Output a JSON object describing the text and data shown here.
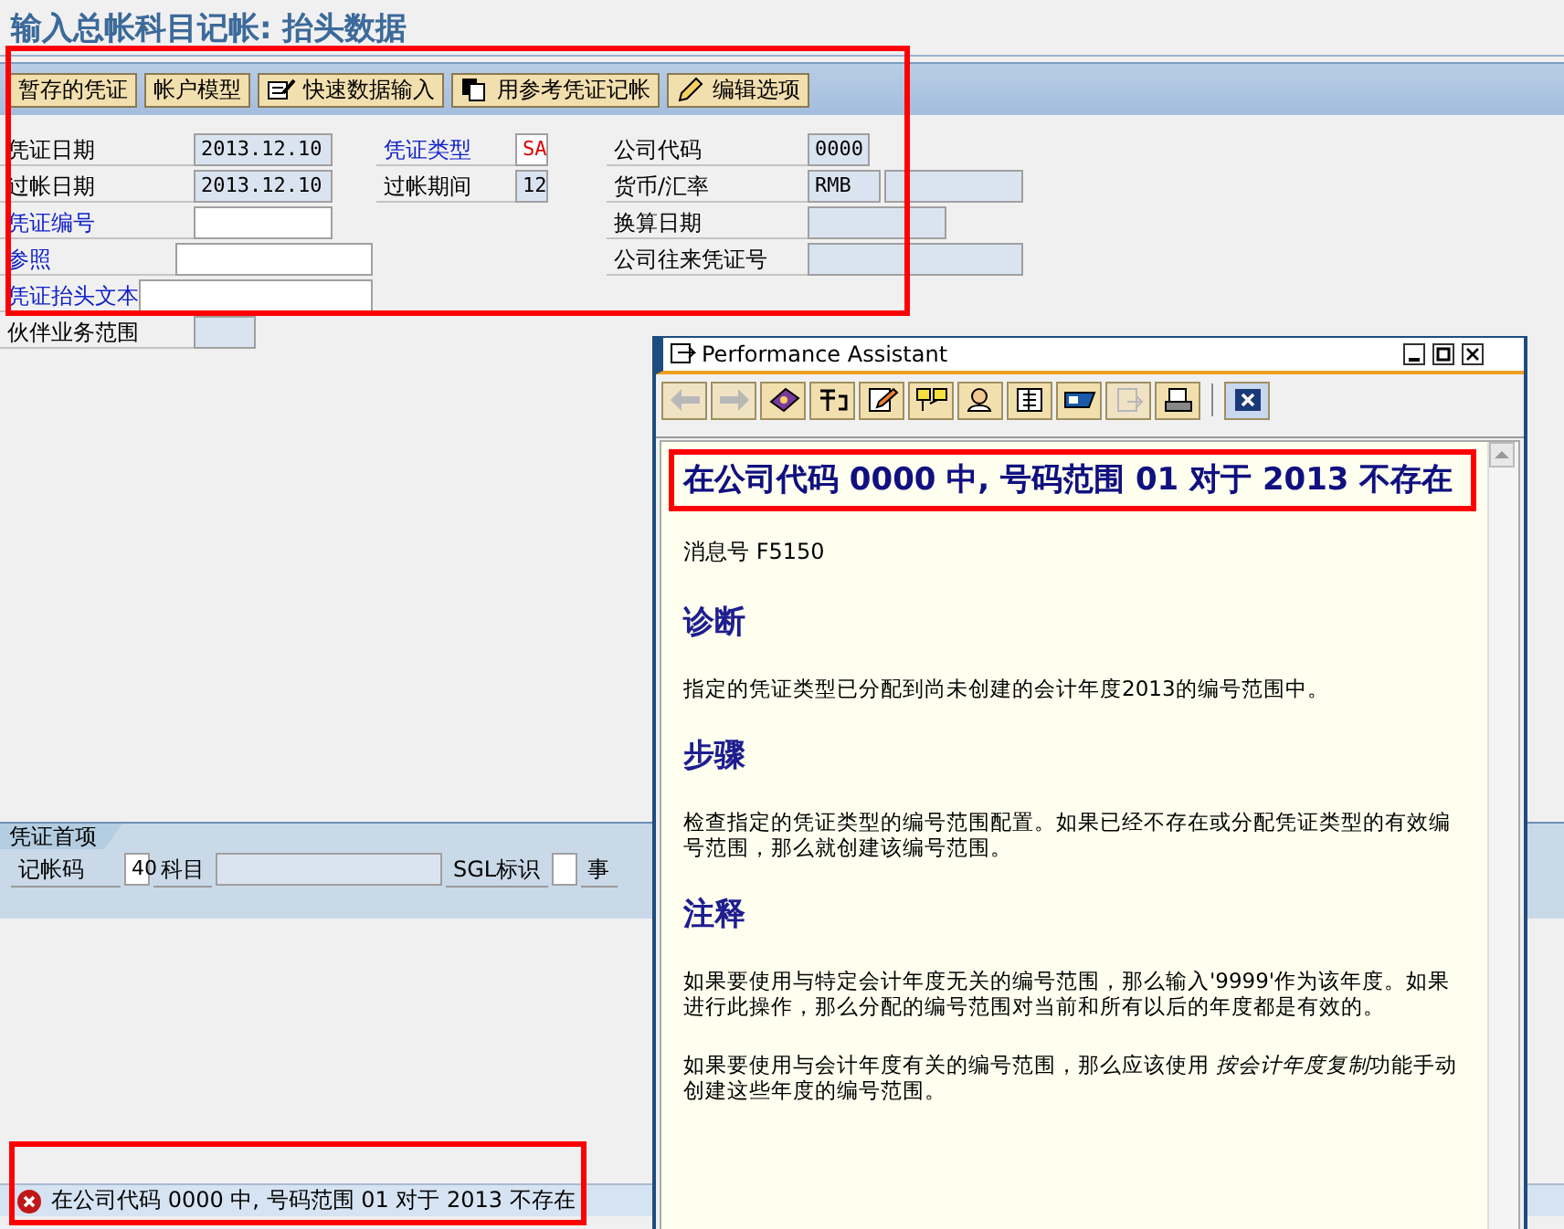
{
  "title": "输入总帐科目记帐: 抬头数据",
  "toolbar": [
    {
      "label": "暂存的凭证",
      "kind": "plain"
    },
    {
      "label": "帐户模型",
      "kind": "plain"
    },
    {
      "label": "快速数据输入",
      "kind": "form"
    },
    {
      "label": "用参考凭证记帐",
      "kind": "copy"
    },
    {
      "label": "编辑选项",
      "kind": "pencil"
    }
  ],
  "columns": [
    [
      {
        "label": "凭证日期",
        "link": false,
        "value": "2013.12.10",
        "editable": false,
        "kind": "medium"
      },
      {
        "label": "过帐日期",
        "link": false,
        "value": "2013.12.10",
        "editable": false,
        "kind": "medium"
      },
      {
        "label": "凭证编号",
        "link": true,
        "editable": true,
        "kind": "medium"
      },
      {
        "label": "参照",
        "link": true,
        "editable": true,
        "kind": "long"
      },
      {
        "label": "凭证抬头文本",
        "link": true,
        "editable": true,
        "kind": "wide"
      },
      {
        "label": "伙伴业务范围",
        "link": false,
        "editable": false,
        "kind": "short"
      }
    ],
    [
      {
        "label": "凭证类型",
        "link": true,
        "value": "SA",
        "editable": true,
        "emphasis": true,
        "kind": "tiny"
      },
      {
        "label": "过帐期间",
        "link": false,
        "value": "12",
        "editable": false,
        "kind": "tiny"
      }
    ],
    [
      {
        "label": "公司代码",
        "link": false,
        "value": "0000",
        "editable": false,
        "kind": "short"
      },
      {
        "label": "货币/汇率",
        "link": false,
        "value": "RMB",
        "editable": false,
        "kind": "pair"
      },
      {
        "label": "换算日期",
        "link": false,
        "editable": false,
        "kind": "medium"
      },
      {
        "label": "公司往来凭证号",
        "link": false,
        "editable": false,
        "kind": "long"
      }
    ]
  ],
  "tab": {
    "label": "凭证首项",
    "selected": true
  },
  "item_row": [
    {
      "label": "记帐码",
      "value": "40",
      "kind": "tiny"
    },
    {
      "label": "科目",
      "kind": "long"
    },
    {
      "label": "SGL标识",
      "kind": "tiny"
    },
    {
      "label": "事"
    }
  ],
  "status": {
    "kind": "error",
    "message": "在公司代码 0000 中, 号码范围 01 对于 2013 不存在"
  },
  "assistant": {
    "title": "Performance Assistant",
    "tools": [
      {
        "kind": "back",
        "disabled": true
      },
      {
        "kind": "forward",
        "disabled": true
      },
      {
        "kind": "book",
        "disabled": false
      },
      {
        "kind": "tools",
        "disabled": false
      },
      {
        "kind": "edit",
        "disabled": false
      },
      {
        "kind": "note",
        "disabled": false
      },
      {
        "kind": "person",
        "disabled": false
      },
      {
        "kind": "document",
        "disabled": false
      },
      {
        "kind": "tag",
        "disabled": false
      },
      {
        "kind": "export",
        "disabled": true
      },
      {
        "kind": "print",
        "disabled": false
      }
    ],
    "heading": "在公司代码  0000 中, 号码范围  01 对于  2013 不存在",
    "message_number": "消息号  F5150",
    "sections": [
      {
        "heading": "诊断",
        "paragraphs": [
          "指定的凭证类型已分配到尚未创建的会计年度2013的编号范围中。"
        ]
      },
      {
        "heading": "步骤",
        "paragraphs": [
          "检查指定的凭证类型的编号范围配置。如果已经不存在或分配凭证类型的有效编号范围，那么就创建该编号范围。"
        ]
      },
      {
        "heading": "注释",
        "paragraphs": [
          "如果要使用与特定会计年度无关的编号范围，那么输入'9999'作为该年度。如果进行此操作，那么分配的编号范围对当前和所有以后的年度都是有效的。",
          [
            {
              "text": "如果要使用与会计年度有关的编号范围，那么应该使用 ",
              "italic": false
            },
            {
              "text": "按会计年度复制",
              "italic": true
            },
            {
              "text": "功能手动创建这些年度的编号范围。",
              "italic": false
            }
          ]
        ]
      }
    ]
  }
}
